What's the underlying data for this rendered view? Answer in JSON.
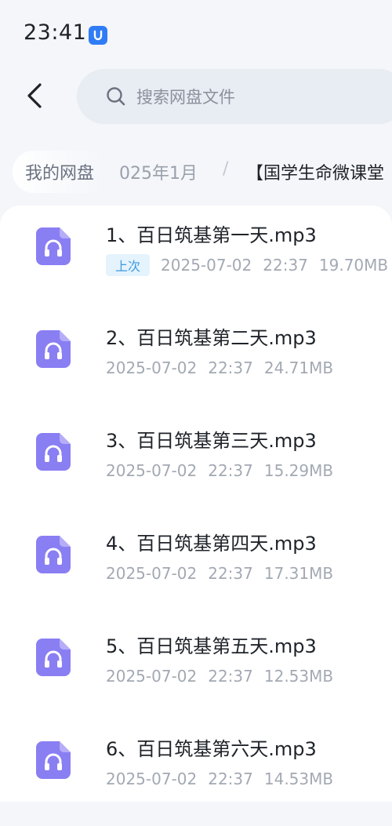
{
  "status_bar": {
    "time": "23:41",
    "app_icon": "baidu-netdisk-icon"
  },
  "header": {
    "back_icon": "chevron-left-icon",
    "search_icon": "search-icon",
    "search_placeholder": "搜索网盘文件"
  },
  "breadcrumb": {
    "root": "我的网盘",
    "middle": "025年1月",
    "separator": "/",
    "current": "【国学生命微课堂"
  },
  "files": [
    {
      "name": "1、百日筑基第一天.mp3",
      "badge": "上次",
      "date": "2025-07-02",
      "time": "22:37",
      "size": "19.70MB",
      "icon": "audio-file-icon"
    },
    {
      "name": "2、百日筑基第二天.mp3",
      "date": "2025-07-02",
      "time": "22:37",
      "size": "24.71MB",
      "icon": "audio-file-icon"
    },
    {
      "name": "3、百日筑基第三天.mp3",
      "date": "2025-07-02",
      "time": "22:37",
      "size": "15.29MB",
      "icon": "audio-file-icon"
    },
    {
      "name": "4、百日筑基第四天.mp3",
      "date": "2025-07-02",
      "time": "22:37",
      "size": "17.31MB",
      "icon": "audio-file-icon"
    },
    {
      "name": "5、百日筑基第五天.mp3",
      "date": "2025-07-02",
      "time": "22:37",
      "size": "12.53MB",
      "icon": "audio-file-icon"
    },
    {
      "name": "6、百日筑基第六天.mp3",
      "date": "2025-07-02",
      "time": "22:37",
      "size": "14.53MB",
      "icon": "audio-file-icon"
    }
  ],
  "colors": {
    "accent": "#2f7cf6",
    "file_icon": "#8a7ef3",
    "badge_bg": "#e5f3fd",
    "badge_text": "#3a9be0"
  }
}
